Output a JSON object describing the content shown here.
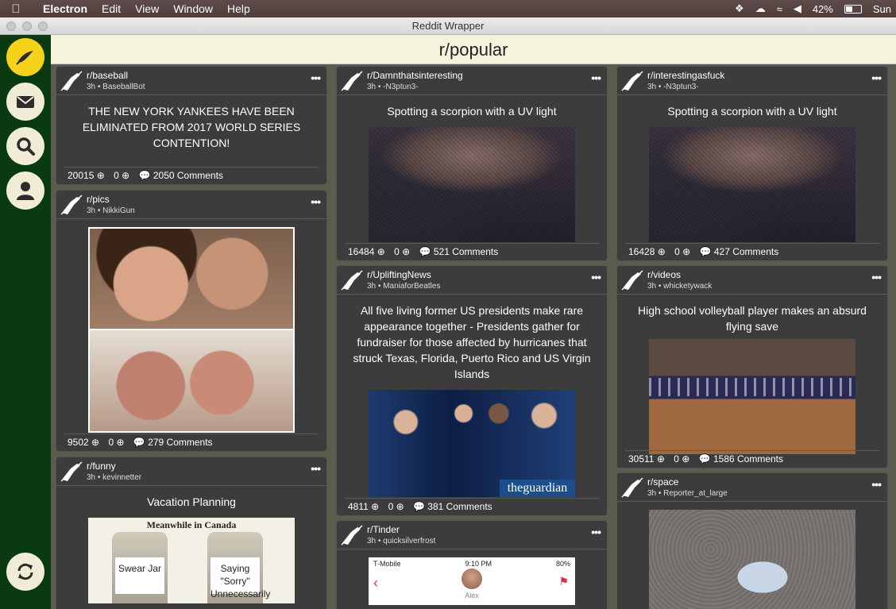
{
  "menubar": {
    "app": "Electron",
    "menus": [
      "Edit",
      "View",
      "Window",
      "Help"
    ],
    "battery": "42%",
    "clock": "Sun"
  },
  "window": {
    "title": "Reddit Wrapper"
  },
  "header": {
    "title": "r/popular"
  },
  "posts": [
    {
      "subreddit": "r/baseball",
      "meta": "3h • BaseballBot",
      "title": "THE NEW YORK YANKEES HAVE BEEN ELIMINATED FROM 2017 WORLD SERIES CONTENTION!",
      "up": "20015",
      "down": "0",
      "comments": "2050 Comments"
    },
    {
      "subreddit": "r/pics",
      "meta": "3h • NikkiGun",
      "title": "",
      "up": "9502",
      "down": "0",
      "comments": "279 Comments"
    },
    {
      "subreddit": "r/funny",
      "meta": "3h • kevinnetter",
      "title": "Vacation Planning",
      "image_caption": "Meanwhile in Canada",
      "jar_left": "Swear Jar",
      "jar_right": "Saying \"Sorry\" Unnecessarily"
    },
    {
      "subreddit": "r/Damnthatsinteresting",
      "meta": "3h • -N3ptun3-",
      "title": "Spotting a scorpion with a UV light",
      "up": "16484",
      "down": "0",
      "comments": "521 Comments"
    },
    {
      "subreddit": "r/UpliftingNews",
      "meta": "3h • ManiaforBeatles",
      "title": "All five living former US presidents make rare appearance together - Presidents gather for fundraiser for those affected by hurricanes that struck Texas, Florida, Puerto Rico and US Virgin Islands",
      "image_brand": "theguardian",
      "up": "4811",
      "down": "0",
      "comments": "381 Comments"
    },
    {
      "subreddit": "r/Tinder",
      "meta": "3h • quicksilverfrost",
      "carrier": "T-Mobile",
      "time": "9:10 PM",
      "phone_battery": "80%",
      "match_name": "Alex"
    },
    {
      "subreddit": "r/interestingasfuck",
      "meta": "3h • -N3ptun3-",
      "title": "Spotting a scorpion with a UV light",
      "up": "16428",
      "down": "0",
      "comments": "427 Comments"
    },
    {
      "subreddit": "r/videos",
      "meta": "3h • whicketywack",
      "title": "High school volleyball player makes an absurd flying save",
      "up": "30511",
      "down": "0",
      "comments": "1586 Comments"
    },
    {
      "subreddit": "r/space",
      "meta": "3h • Reporter_at_large",
      "title": ""
    }
  ],
  "icons": {
    "sidebar": [
      "home-icon",
      "mail-icon",
      "search-icon",
      "profile-icon",
      "refresh-icon"
    ],
    "accent": "#f7d21a",
    "sidebar_bg": "#0a3a12"
  }
}
